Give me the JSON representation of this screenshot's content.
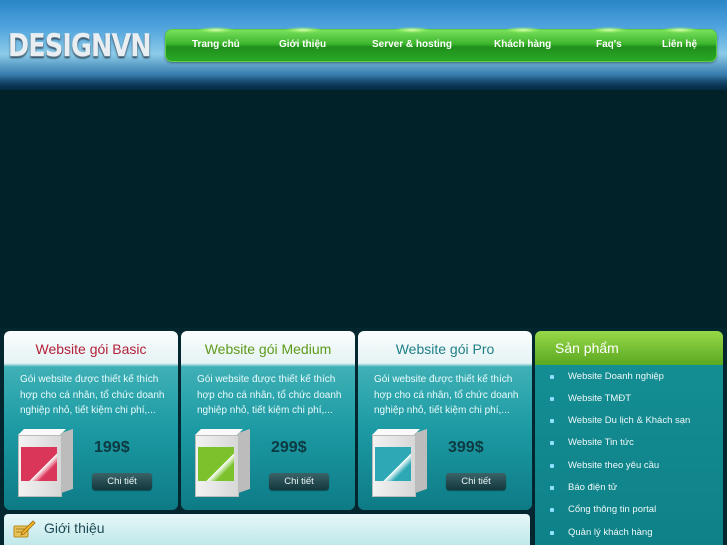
{
  "logo": "DESIGNVN",
  "nav": [
    {
      "label": "Trang chủ"
    },
    {
      "label": "Giới thiệu"
    },
    {
      "label": "Server & hosting"
    },
    {
      "label": "Khách hàng"
    },
    {
      "label": "Faq's"
    },
    {
      "label": "Liên hệ"
    }
  ],
  "packages": [
    {
      "title": "Website gói Basic",
      "title_color": "#b3213a",
      "desc": "Gói website được thiết kế thích hợp cho cá nhân, tổ chức doanh nghiệp nhỏ, tiết kiệm chi phí,...",
      "price": "199$",
      "button": "Chi tiết",
      "box_color": "#d9365a"
    },
    {
      "title": "Website gói Medium",
      "title_color": "#5e9a1a",
      "desc": "Gói website được thiết kế thích hợp cho cá nhân, tổ chức doanh nghiệp nhỏ, tiết kiệm chi phí,...",
      "price": "299$",
      "button": "Chi tiết",
      "box_color": "#7cc22d"
    },
    {
      "title": "Website gói Pro",
      "title_color": "#1f7f86",
      "desc": "Gói website được thiết kế thích hợp cho cá nhân, tổ chức doanh nghiệp nhỏ, tiết kiệm chi phí,...",
      "price": "399$",
      "button": "Chi tiết",
      "box_color": "#2ea8b4"
    }
  ],
  "sidebar": {
    "title": "Sản phẩm",
    "items": [
      {
        "label": "Website Doanh nghiệp"
      },
      {
        "label": "Website TMĐT"
      },
      {
        "label": "Website Du lịch & Khách sạn"
      },
      {
        "label": "Website Tin tức"
      },
      {
        "label": "Website theo yêu cầu"
      },
      {
        "label": "Báo điện tử"
      },
      {
        "label": "Cổng thông tin portal"
      },
      {
        "label": "Quản lý khách hàng"
      }
    ]
  },
  "intro": {
    "title": "Giới thiệu"
  }
}
